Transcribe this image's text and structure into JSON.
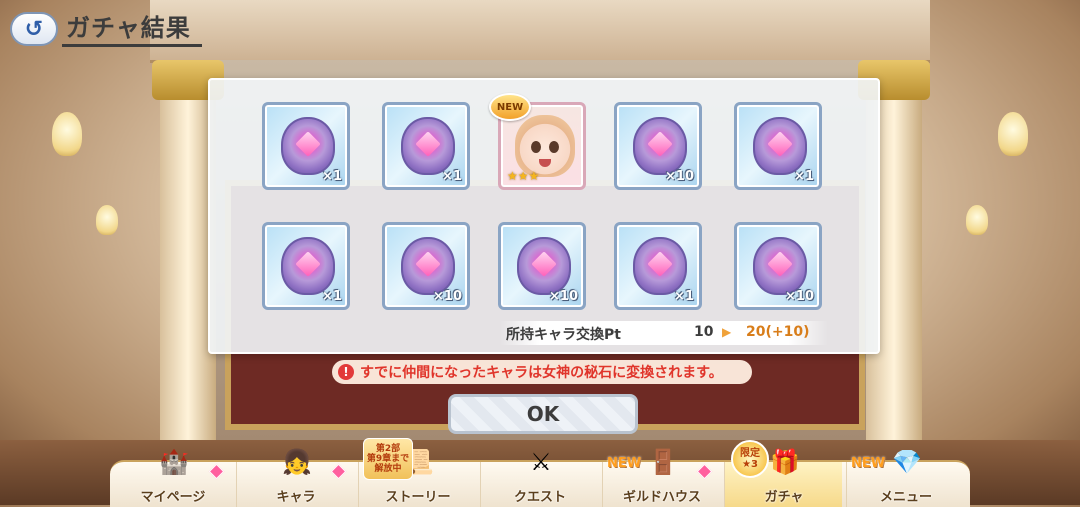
{
  "header": {
    "title": "ガチャ結果",
    "back_icon": "back-arrow-icon"
  },
  "results": [
    {
      "type": "item",
      "icon": "goddess-stone-icon",
      "quantity": "×1"
    },
    {
      "type": "item",
      "icon": "goddess-stone-icon",
      "quantity": "×1"
    },
    {
      "type": "character",
      "icon": "character-portrait",
      "badge": "NEW",
      "stars": "★★★"
    },
    {
      "type": "item",
      "icon": "goddess-stone-icon",
      "quantity": "×10"
    },
    {
      "type": "item",
      "icon": "goddess-stone-icon",
      "quantity": "×1"
    },
    {
      "type": "item",
      "icon": "goddess-stone-icon",
      "quantity": "×1"
    },
    {
      "type": "item",
      "icon": "goddess-stone-icon",
      "quantity": "×10"
    },
    {
      "type": "item",
      "icon": "goddess-stone-icon",
      "quantity": "×10"
    },
    {
      "type": "item",
      "icon": "goddess-stone-icon",
      "quantity": "×1"
    },
    {
      "type": "item",
      "icon": "goddess-stone-icon",
      "quantity": "×10"
    }
  ],
  "exchange_pt": {
    "label": "所持キャラ交換Pt",
    "current": "10",
    "arrow": "▶",
    "new_value": "20(+10)"
  },
  "notice": {
    "icon": "!",
    "text": "すでに仲間になったキャラは女神の秘石に変換されます。"
  },
  "ok_button": {
    "label": "OK"
  },
  "nav": {
    "items": [
      {
        "label": "マイページ",
        "icon": "castle-icon"
      },
      {
        "label": "キャラ",
        "icon": "character-icon"
      },
      {
        "label": "ストーリー",
        "icon": "scroll-icon",
        "badge_lines": [
          "第2部",
          "第9章まで",
          "解放中"
        ]
      },
      {
        "label": "クエスト",
        "icon": "swords-icon"
      },
      {
        "label": "ギルドハウス",
        "icon": "door-icon",
        "badge": "NEW"
      },
      {
        "label": "ガチャ",
        "icon": "gacha-icon",
        "limited_lines": [
          "限定",
          "★3"
        ]
      },
      {
        "label": "メニュー",
        "icon": "crystal-icon",
        "badge": "NEW"
      }
    ]
  },
  "colors": {
    "accent_orange": "#d87d1a",
    "warning_red": "#e0352b",
    "gold_frame": "#c9a25c"
  }
}
